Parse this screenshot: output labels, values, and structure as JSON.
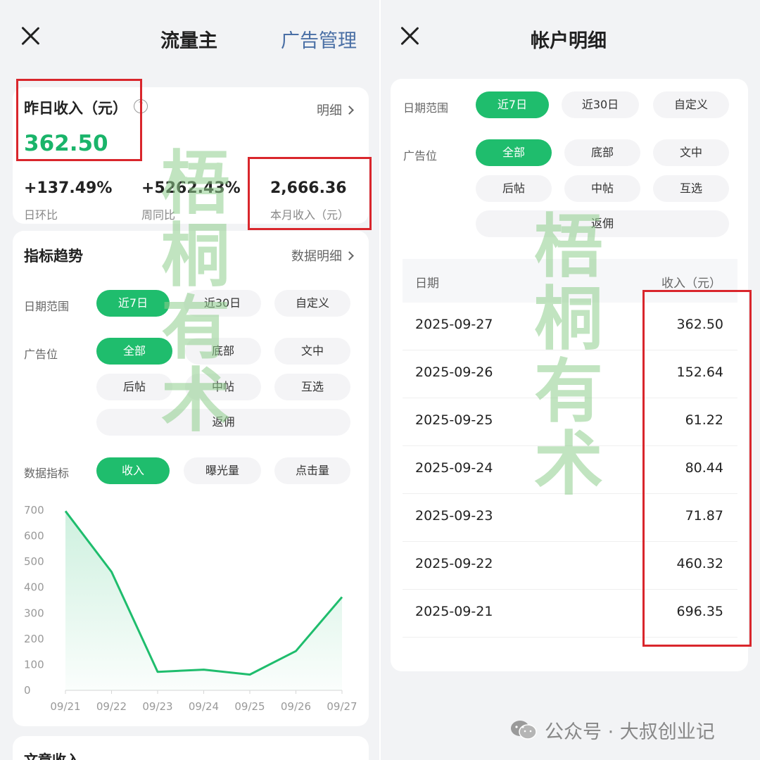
{
  "left": {
    "title": "流量主",
    "ad_manage": "广告管理",
    "yesterday": {
      "label": "昨日收入（元）",
      "help": "?",
      "detail": "明细",
      "amount": "362.50"
    },
    "stats": [
      {
        "value": "+137.49%",
        "label": "日环比"
      },
      {
        "value": "+5262.43%",
        "label": "周同比"
      },
      {
        "value": "2,666.36",
        "label": "本月收入（元）"
      }
    ],
    "trend": {
      "title": "指标趋势",
      "detail": "数据明细",
      "date_range": {
        "label": "日期范围",
        "options": [
          "近7日",
          "近30日",
          "自定义"
        ],
        "selected": "近7日"
      },
      "ad_slot": {
        "label": "广告位",
        "options": [
          "全部",
          "底部",
          "文中",
          "后帖",
          "中帖",
          "互选",
          "返佣"
        ],
        "selected": "全部"
      },
      "metric": {
        "label": "数据指标",
        "options": [
          "收入",
          "曝光量",
          "点击量"
        ],
        "selected": "收入"
      }
    },
    "article_section": "文章收入"
  },
  "right": {
    "title": "帐户明细",
    "date_range": {
      "label": "日期范围",
      "options": [
        "近7日",
        "近30日",
        "自定义"
      ],
      "selected": "近7日"
    },
    "ad_slot": {
      "label": "广告位",
      "options": [
        "全部",
        "底部",
        "文中",
        "后帖",
        "中帖",
        "互选",
        "返佣"
      ],
      "selected": "全部"
    },
    "table": {
      "headers": [
        "日期",
        "收入（元）"
      ],
      "rows": [
        {
          "date": "2025-09-27",
          "income": "362.50"
        },
        {
          "date": "2025-09-26",
          "income": "152.64"
        },
        {
          "date": "2025-09-25",
          "income": "61.22"
        },
        {
          "date": "2025-09-24",
          "income": "80.44"
        },
        {
          "date": "2025-09-23",
          "income": "71.87"
        },
        {
          "date": "2025-09-22",
          "income": "460.32"
        },
        {
          "date": "2025-09-21",
          "income": "696.35"
        }
      ]
    }
  },
  "watermark": {
    "text": "梧桐有术"
  },
  "footer": {
    "source": "公众号 · 大叔创业记"
  },
  "colors": {
    "accent_green": "#1fbd6d",
    "income_green": "#1ab46a",
    "highlight_red": "#d9262c",
    "link_blue": "#4a6fa5"
  },
  "chart_data": {
    "type": "area",
    "categories": [
      "09/21",
      "09/22",
      "09/23",
      "09/24",
      "09/25",
      "09/26",
      "09/27"
    ],
    "values": [
      696.35,
      460.32,
      71.87,
      80.44,
      61.22,
      152.64,
      362.5
    ],
    "yticks": [
      0,
      100,
      200,
      300,
      400,
      500,
      600,
      700
    ],
    "ylim": [
      0,
      700
    ],
    "color": "#1fbd6d"
  }
}
